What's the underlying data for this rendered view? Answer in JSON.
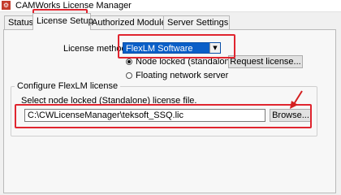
{
  "window": {
    "title": "CAMWorks License Manager"
  },
  "tabs": [
    {
      "label": "Status"
    },
    {
      "label": "License Setup",
      "active": true
    },
    {
      "label": "Authorized Modules"
    },
    {
      "label": "Server Settings"
    }
  ],
  "license_method": {
    "label": "License method",
    "selected": "FlexLM Software"
  },
  "radios": [
    {
      "label": "Node locked (standalone)",
      "checked": true
    },
    {
      "label": "Floating network server",
      "checked": false
    }
  ],
  "buttons": {
    "request_license": "Request license...",
    "browse": "Browse..."
  },
  "flexlm_group": {
    "title": "Configure FlexLM license",
    "prompt": "Select node locked (Standalone) license file.",
    "file_path": "C:\\CWLicenseManager\\teksoft_SSQ.lic"
  },
  "colors": {
    "highlight": "#e0252f",
    "select_bg": "#0a5fc8",
    "arrow": "#d42020"
  }
}
